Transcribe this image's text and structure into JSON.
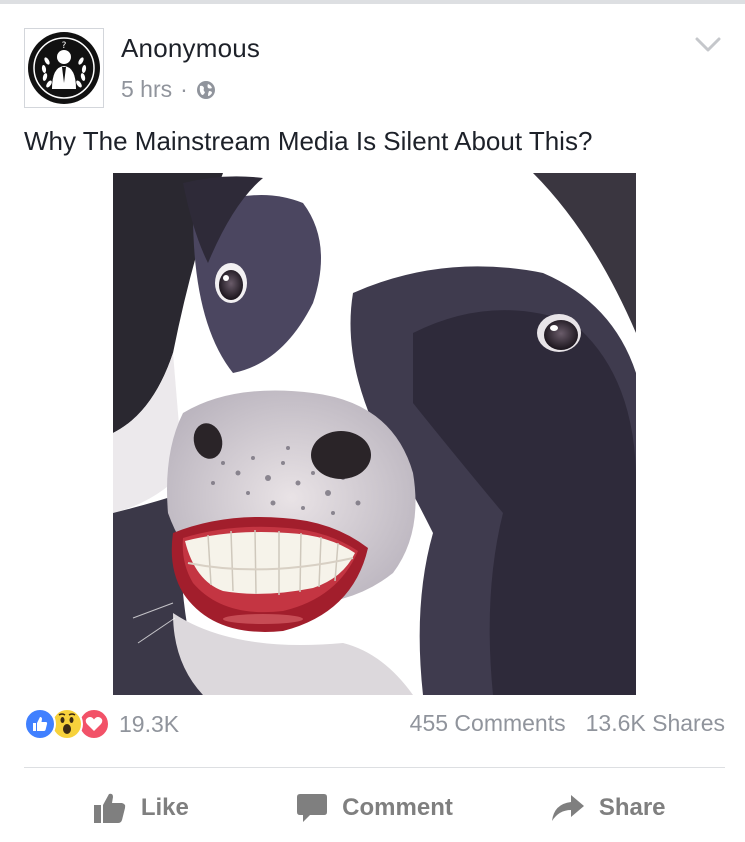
{
  "post": {
    "author": "Anonymous",
    "timestamp": "5 hrs",
    "separator": "·",
    "privacy_icon": "globe-icon",
    "caption": "Why The Mainstream Media Is Silent About This?",
    "image_subject": "cow-with-human-smile-photo"
  },
  "stats": {
    "reactions": [
      "like-reaction-icon",
      "wow-reaction-icon",
      "love-reaction-icon"
    ],
    "reaction_count": "19.3K",
    "comments": "455 Comments",
    "shares": "13.6K Shares"
  },
  "actions": {
    "like_label": "Like",
    "comment_label": "Comment",
    "share_label": "Share"
  },
  "colors": {
    "text": "#1d2129",
    "secondary": "#90949c",
    "like_blue": "#4080ff",
    "love_red": "#f25268",
    "wow_yellow": "#f7d23c",
    "action_gray": "#7f7f7f"
  }
}
